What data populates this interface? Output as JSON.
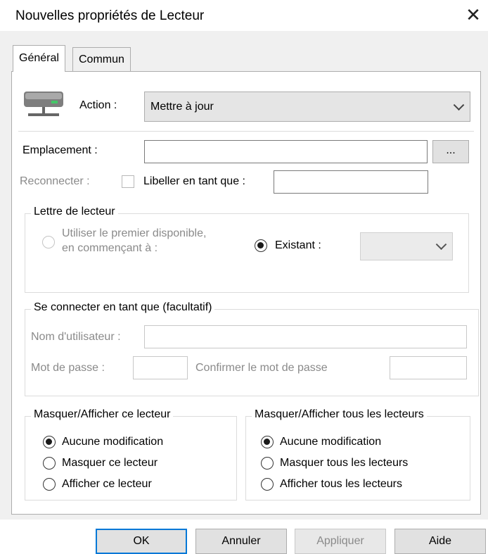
{
  "window": {
    "title": "Nouvelles propriétés de Lecteur",
    "close_glyph": "✕"
  },
  "tabs": [
    {
      "label": "Général",
      "active": true
    },
    {
      "label": "Commun",
      "active": false
    }
  ],
  "action": {
    "label": "Action :",
    "value": "Mettre à jour"
  },
  "location": {
    "label": "Emplacement :",
    "value": "",
    "browse_label": "..."
  },
  "reconnect": {
    "label": "Reconnecter :",
    "checked": false
  },
  "label_as": {
    "label": "Libeller en tant que :",
    "value": ""
  },
  "drive_letter": {
    "legend": "Lettre de lecteur",
    "first_available_line1": "Utiliser le premier disponible,",
    "first_available_line2": "en commençant à :",
    "existing_label": "Existant :",
    "existing_value": ""
  },
  "connect_as": {
    "legend": "Se connecter en tant que (facultatif)",
    "username_label": "Nom d'utilisateur :",
    "password_label": "Mot de passe :",
    "confirm_label": "Confirmer le mot de passe"
  },
  "hide_show_drive": {
    "legend": "Masquer/Afficher ce lecteur",
    "options": [
      "Aucune modification",
      "Masquer ce lecteur",
      "Afficher ce lecteur"
    ],
    "selected": 0
  },
  "hide_show_all": {
    "legend": "Masquer/Afficher tous les lecteurs",
    "options": [
      "Aucune modification",
      "Masquer tous les lecteurs",
      "Afficher tous les lecteurs"
    ],
    "selected": 0
  },
  "buttons": {
    "ok": "OK",
    "cancel": "Annuler",
    "apply": "Appliquer",
    "help": "Aide"
  },
  "colors": {
    "accent": "#0078d7",
    "drive_icon_light": "#44c767"
  }
}
